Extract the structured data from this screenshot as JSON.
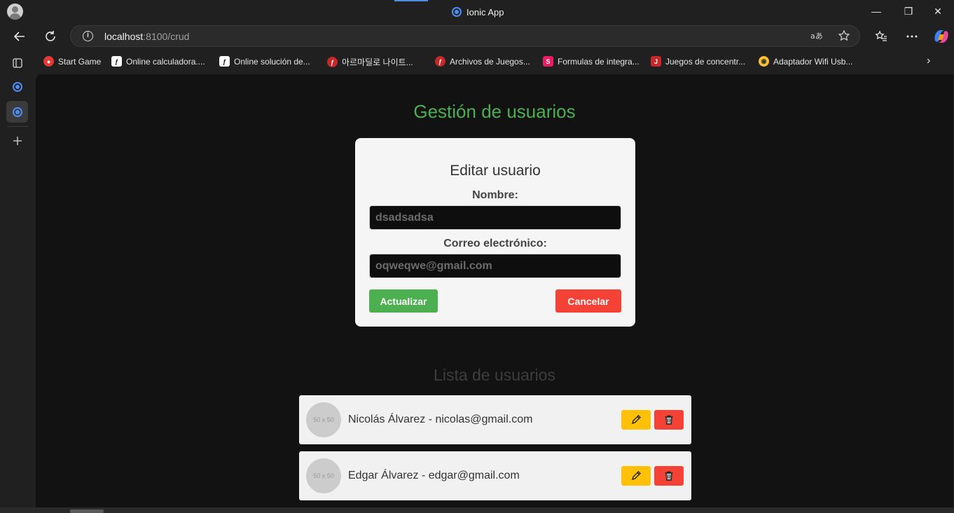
{
  "window": {
    "title": "Ionic App",
    "controls": {
      "minimize": "—",
      "maximize": "❐",
      "close": "✕"
    }
  },
  "toolbar": {
    "url_host": "localhost",
    "url_path": ":8100/crud",
    "icons": [
      "back-icon",
      "refresh-icon",
      "site-info-icon",
      "read-aloud-icon",
      "favorite-star-icon",
      "favorites-icon",
      "more-icon",
      "copilot-icon"
    ]
  },
  "bookmarks": [
    {
      "label": "Start Game",
      "color": "#e53935"
    },
    {
      "label": "Online calculadora....",
      "color": "#ffffff"
    },
    {
      "label": "Online solución de...",
      "color": "#ffffff"
    },
    {
      "label": "아르마딜로 나이트...",
      "color": "#c62828"
    },
    {
      "label": "Archivos de Juegos...",
      "color": "#c62828"
    },
    {
      "label": "Formulas de integra...",
      "color": "#e91e63"
    },
    {
      "label": "Juegos de concentr...",
      "color": "#c62828"
    },
    {
      "label": "Adaptador Wifi Usb...",
      "color": "#fbc02d"
    }
  ],
  "page": {
    "title": "Gestión de usuarios",
    "form": {
      "title": "Editar usuario",
      "name_label": "Nombre:",
      "name_value": "dsadsadsa",
      "email_label": "Correo electrónico:",
      "email_value": "oqweqwe@gmail.com",
      "update_label": "Actualizar",
      "cancel_label": "Cancelar"
    },
    "list_title": "Lista de usuarios",
    "users": [
      {
        "avatar": "50 x 50",
        "text": "Nicolás Álvarez - nicolas@gmail.com"
      },
      {
        "avatar": "50 x 50",
        "text": "Edgar Álvarez - edgar@gmail.com"
      }
    ]
  },
  "colors": {
    "title_green": "#4caf50",
    "update_button": "#4caf50",
    "cancel_button": "#f44336",
    "edit_button": "#ffc107",
    "delete_button": "#f44336"
  }
}
